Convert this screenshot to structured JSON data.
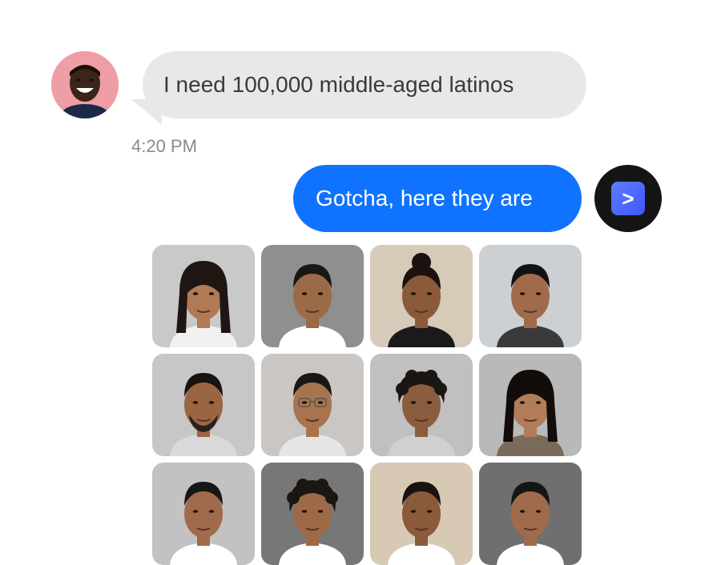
{
  "conversation": {
    "incoming": {
      "text": "I need 100,000 middle-aged latinos",
      "timestamp": "4:20 PM",
      "avatar_icon": "smiling-person-avatar",
      "avatar_bg": "#ee9ea4",
      "bubble_color": "#e8e8ea"
    },
    "outgoing": {
      "text": "Gotcha, here they are",
      "avatar_icon": "terminal-prompt-icon",
      "avatar_glyph": ">",
      "bubble_color": "#0f73ff"
    }
  },
  "faces": [
    {
      "bg": "#c9c9c9",
      "skin": "#b07a55",
      "hair": "#1e1612",
      "shirt": "#f1f1f1",
      "style": "long"
    },
    {
      "bg": "#8f8f8f",
      "skin": "#9c6a47",
      "hair": "#1b1714",
      "shirt": "#ffffff",
      "style": "short"
    },
    {
      "bg": "#d6cab8",
      "skin": "#8a5a3a",
      "hair": "#1a120e",
      "shirt": "#1a1a1a",
      "style": "bun"
    },
    {
      "bg": "#cdd0d3",
      "skin": "#a06b4a",
      "hair": "#121212",
      "shirt": "#3a3a3a",
      "style": "short"
    },
    {
      "bg": "#c7c7c7",
      "skin": "#9a6543",
      "hair": "#161311",
      "shirt": "#d9d9d9",
      "style": "beard"
    },
    {
      "bg": "#c9c6c3",
      "skin": "#a8744f",
      "hair": "#1a1817",
      "shirt": "#e6e6e6",
      "style": "glasses"
    },
    {
      "bg": "#c0c0c0",
      "skin": "#8a5d3e",
      "hair": "#1c1612",
      "shirt": "#d0d0d0",
      "style": "curly"
    },
    {
      "bg": "#b9b9b9",
      "skin": "#b07d58",
      "hair": "#120d0a",
      "shirt": "#7a6a5a",
      "style": "long"
    },
    {
      "bg": "#c2c2c2",
      "skin": "#a06b4a",
      "hair": "#161616",
      "shirt": "#ffffff",
      "style": "short"
    },
    {
      "bg": "#777777",
      "skin": "#9c6a47",
      "hair": "#1a1614",
      "shirt": "#ffffff",
      "style": "curly"
    },
    {
      "bg": "#d8c9b5",
      "skin": "#8a5a3a",
      "hair": "#1a120e",
      "shirt": "#ffffff",
      "style": "short"
    },
    {
      "bg": "#6f6f6f",
      "skin": "#a06b4a",
      "hair": "#151515",
      "shirt": "#ffffff",
      "style": "short"
    }
  ]
}
